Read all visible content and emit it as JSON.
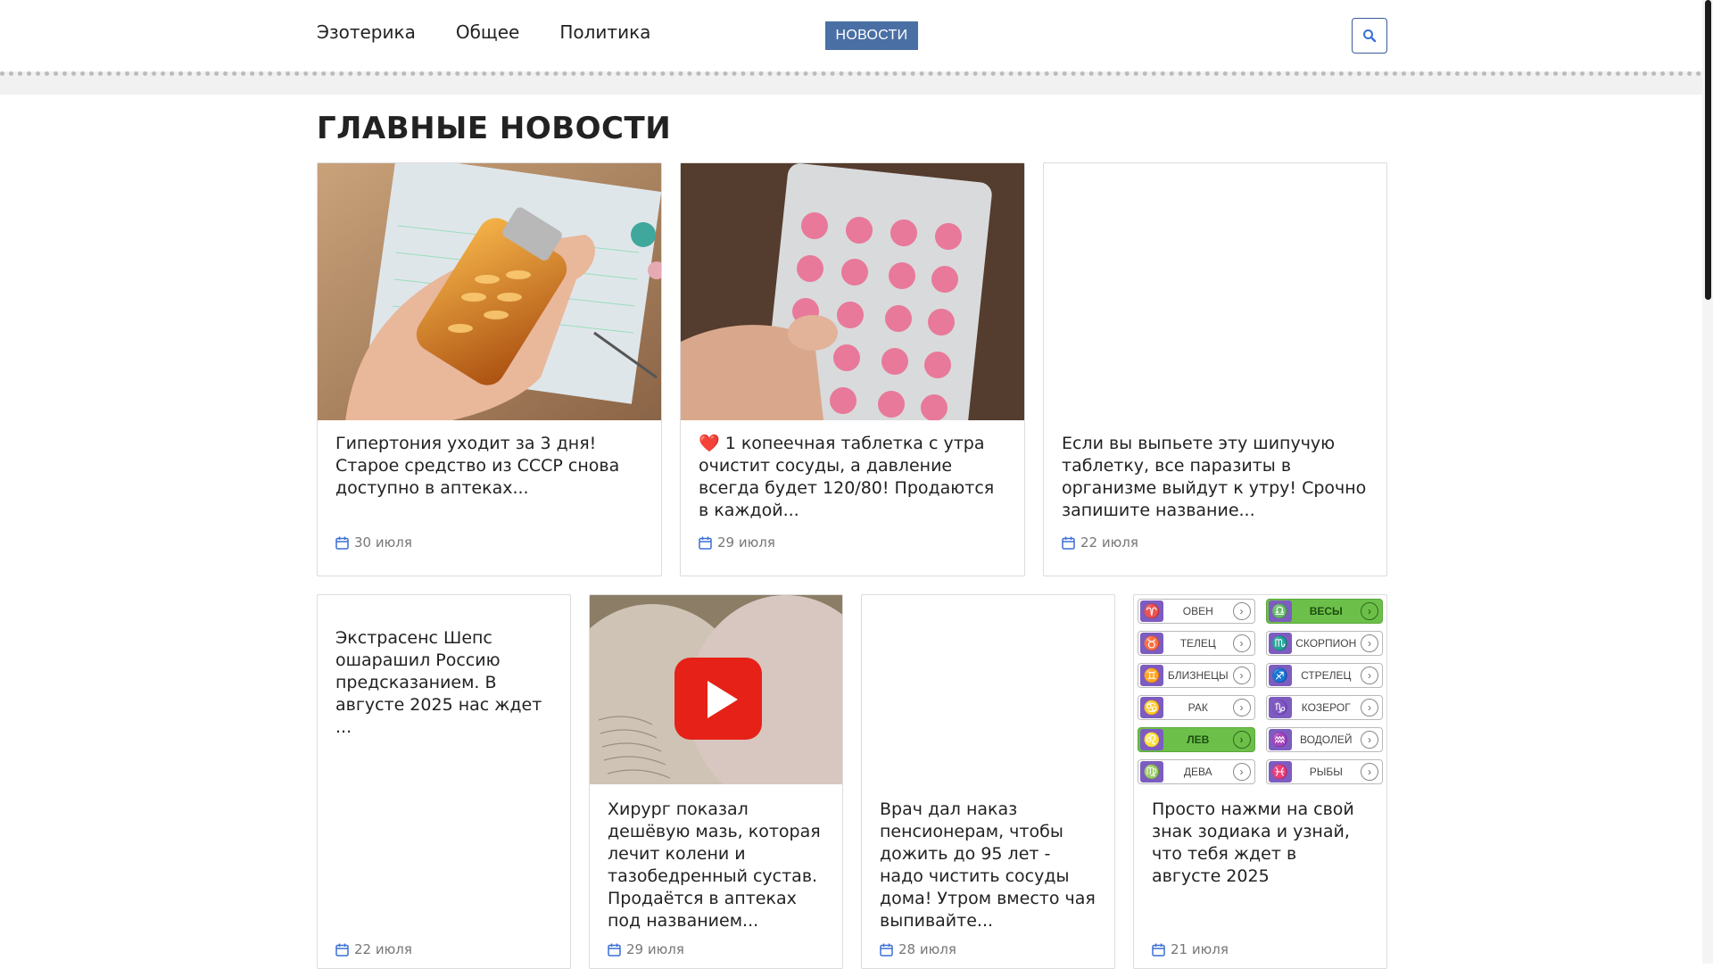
{
  "nav": {
    "items": [
      "Эзотерика",
      "Общее",
      "Политика"
    ],
    "badge": "НОВОСТИ"
  },
  "page": {
    "title": "ГЛАВНЫЕ НОВОСТИ"
  },
  "articles": [
    {
      "text": "Гипертония уходит за 3 дня! Старое средство из СССР снова доступно в аптеках...",
      "date": "30 июля"
    },
    {
      "text": "❤️ 1 копеечная таблетка с утра очистит сосуды, а давление всегда будет 120/80! Продаются в каждой...",
      "date": "29 июля"
    },
    {
      "text": "Если вы выпьете эту шипучую таблетку, все паразиты в организме выйдут к утру! Срочно запишите название...",
      "date": "22 июля"
    },
    {
      "text": "Экстрасенс Шепс ошарашил Россию предсказанием. В августе 2025 нас ждет ...",
      "date": "22 июля"
    },
    {
      "text": "Хирург показал дешёвую мазь, которая лечит колени и тазобедренный сустав. Продаётся в аптеках под названием...",
      "date": "29 июля"
    },
    {
      "text": "Врач дал наказ пенсионерам, чтобы дожить до 95 лет - надо чистить сосуды дома! Утром вместо чая выпивайте...",
      "date": "28 июля"
    },
    {
      "text": "Просто нажми на свой знак зодиака и узнай, что тебя ждет в августе 2025",
      "date": "21 июля"
    }
  ],
  "zodiac": [
    {
      "sym": "♈",
      "name": "ОВЕН",
      "active": false
    },
    {
      "sym": "♎",
      "name": "ВЕСЫ",
      "active": true
    },
    {
      "sym": "♉",
      "name": "ТЕЛЕЦ",
      "active": false
    },
    {
      "sym": "♏",
      "name": "СКОРПИОН",
      "active": false
    },
    {
      "sym": "♊",
      "name": "БЛИЗНЕЦЫ",
      "active": false
    },
    {
      "sym": "♐",
      "name": "СТРЕЛЕЦ",
      "active": false
    },
    {
      "sym": "♋",
      "name": "РАК",
      "active": false
    },
    {
      "sym": "♑",
      "name": "КОЗЕРОГ",
      "active": false
    },
    {
      "sym": "♌",
      "name": "ЛЕВ",
      "active": true
    },
    {
      "sym": "♒",
      "name": "ВОДОЛЕЙ",
      "active": false
    },
    {
      "sym": "♍",
      "name": "ДЕВА",
      "active": false
    },
    {
      "sym": "♓",
      "name": "РЫБЫ",
      "active": false
    }
  ],
  "icons": {
    "search": "search-icon",
    "calendar": "calendar-icon",
    "play": "play-icon"
  },
  "colors": {
    "badge": "#4a6fa5",
    "icon_blue": "#3b6fd6",
    "zodiac_active": "#6cc04a",
    "zodiac_symbol": "#7d5cc0",
    "play_red": "#e62117"
  }
}
